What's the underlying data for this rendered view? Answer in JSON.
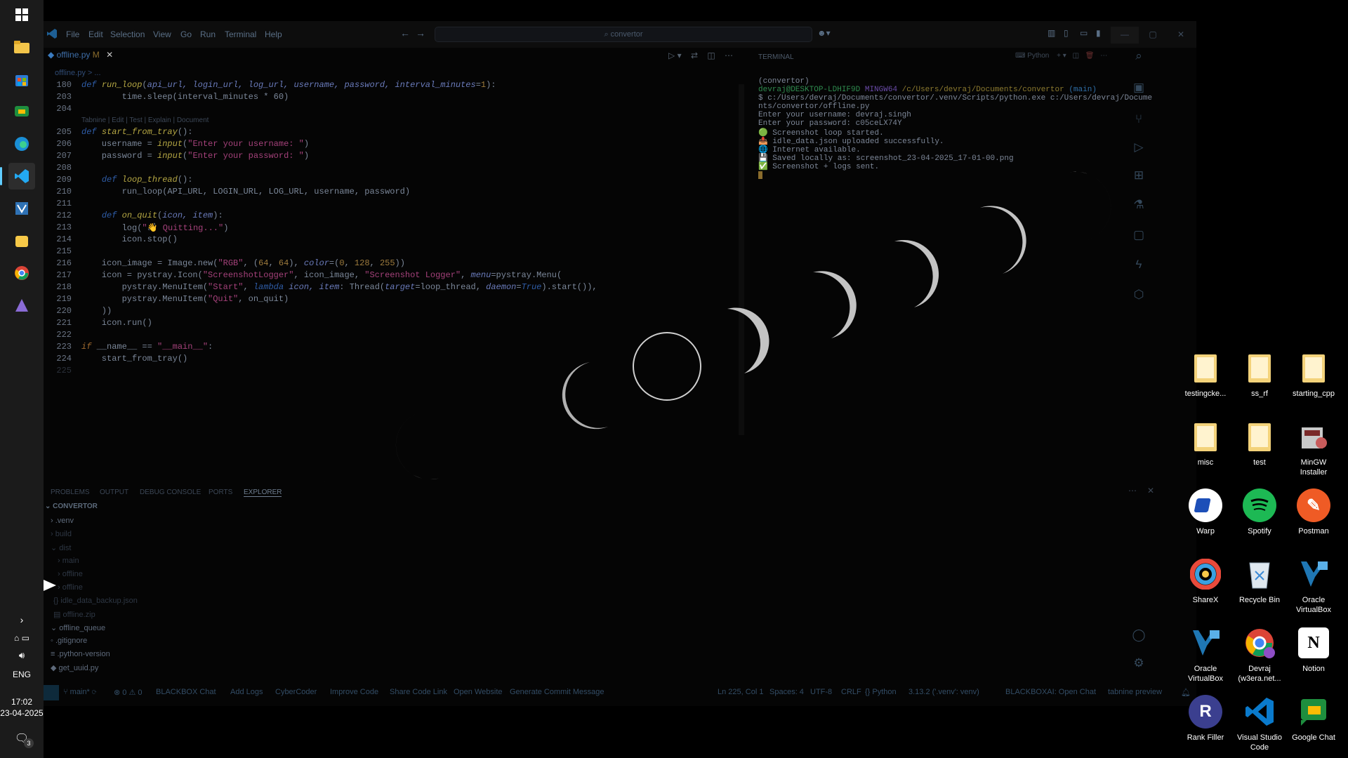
{
  "taskbar": {
    "lang": "ENG",
    "time": "17:02",
    "date": "23-04-2025",
    "notification_count": "3"
  },
  "titlebar": {
    "menu": [
      "File",
      "Edit",
      "Selection",
      "View",
      "Go",
      "Run",
      "Terminal",
      "Help"
    ],
    "search": "convertor"
  },
  "editor": {
    "tab_label": "offline.py",
    "tab_status": "M",
    "breadcrumb": "offline.py > ...",
    "codelens": "Tabnine | Edit | Test | Explain | Document",
    "lines": [
      {
        "n": "180",
        "t": "def run_loop(api_url, login_url, log_url, username, password, interval_minutes=1):"
      },
      {
        "n": "203",
        "t": "        time.sleep(interval_minutes * 60)"
      },
      {
        "n": "204",
        "t": ""
      },
      {
        "n": "205",
        "t": "def start_from_tray():"
      },
      {
        "n": "206",
        "t": "    username = input(\"Enter your username: \")"
      },
      {
        "n": "207",
        "t": "    password = input(\"Enter your password: \")"
      },
      {
        "n": "208",
        "t": ""
      },
      {
        "n": "209",
        "t": "    def loop_thread():"
      },
      {
        "n": "210",
        "t": "        run_loop(API_URL, LOGIN_URL, LOG_URL, username, password)"
      },
      {
        "n": "211",
        "t": ""
      },
      {
        "n": "212",
        "t": "    def on_quit(icon, item):"
      },
      {
        "n": "213",
        "t": "        log(\"👋 Quitting...\")"
      },
      {
        "n": "214",
        "t": "        icon.stop()"
      },
      {
        "n": "215",
        "t": ""
      },
      {
        "n": "216",
        "t": "    icon_image = Image.new(\"RGB\", (64, 64), color=(0, 128, 255))"
      },
      {
        "n": "217",
        "t": "    icon = pystray.Icon(\"ScreenshotLogger\", icon_image, \"Screenshot Logger\", menu=pystray.Menu("
      },
      {
        "n": "218",
        "t": "        pystray.MenuItem(\"Start\", lambda icon, item: Thread(target=loop_thread, daemon=True).start()),"
      },
      {
        "n": "219",
        "t": "        pystray.MenuItem(\"Quit\", on_quit)"
      },
      {
        "n": "220",
        "t": "    ))"
      },
      {
        "n": "221",
        "t": "    icon.run()"
      },
      {
        "n": "222",
        "t": ""
      },
      {
        "n": "223",
        "t": "if __name__ == \"__main__\":"
      },
      {
        "n": "224",
        "t": "    start_from_tray()"
      },
      {
        "n": "225",
        "t": ""
      }
    ]
  },
  "terminal": {
    "title": "TERMINAL",
    "shell": "Python",
    "lines": [
      "(convertor)",
      "devraj@DESKTOP-LDHIF9D MINGW64 /c/Users/devraj/Documents/convertor (main)",
      "$ c:/Users/devraj/Documents/convertor/.venv/Scripts/python.exe c:/Users/devraj/Docume",
      "nts/convertor/offline.py",
      "Enter your username: devraj.singh",
      "Enter your password: c05ceLX74Y",
      "🟢 Screenshot loop started.",
      "📤 idle_data.json uploaded successfully.",
      "🌐 Internet available.",
      "💾 Saved locally as: screenshot_23-04-2025_17-01-00.png",
      "✅ Screenshot + logs sent."
    ]
  },
  "panel": {
    "tabs": [
      "PROBLEMS",
      "OUTPUT",
      "DEBUG CONSOLE",
      "PORTS",
      "EXPLORER"
    ],
    "root": "CONVERTOR",
    "tree": [
      ".venv",
      "build",
      "dist",
      "main",
      "offline",
      "offline",
      "idle_data_backup.json",
      "offline.zip",
      "offline_queue",
      ".gitignore",
      ".python-version",
      "get_uuid.py"
    ]
  },
  "statusbar": {
    "branch": "main*",
    "problems": "⊗ 0 ⚠ 0",
    "items": [
      "BLACKBOX Chat",
      "Add Logs",
      "CyberCoder",
      "Improve Code",
      "Share Code Link",
      "Open Website",
      "Generate Commit Message"
    ],
    "right": [
      "Ln 225, Col 1",
      "Spaces: 4",
      "UTF-8",
      "CRLF",
      "{} Python",
      "3.13.2 ('.venv': venv)",
      "BLACKBOXAI: Open Chat",
      "tabnine preview"
    ]
  },
  "desktop": [
    {
      "label": "testingcke...",
      "icon": "folder-icon",
      "color": "#e8c46a"
    },
    {
      "label": "ss_rf",
      "icon": "folder-icon",
      "color": "#e8c46a"
    },
    {
      "label": "starting_cpp",
      "icon": "folder-icon",
      "color": "#e8c46a"
    },
    {
      "label": "misc",
      "icon": "folder-icon",
      "color": "#e8c46a"
    },
    {
      "label": "test",
      "icon": "folder-icon",
      "color": "#e8c46a"
    },
    {
      "label": "MinGW Installer",
      "icon": "installer-icon",
      "color": "#b64b4b"
    },
    {
      "label": "Warp",
      "icon": "warp-icon",
      "color": "#1d4fb8"
    },
    {
      "label": "Spotify",
      "icon": "spotify-icon",
      "color": "#1db954"
    },
    {
      "label": "Postman",
      "icon": "postman-icon",
      "color": "#ef5b25"
    },
    {
      "label": "ShareX",
      "icon": "sharex-icon",
      "color": "#3aa0e0"
    },
    {
      "label": "Recycle Bin",
      "icon": "recycle-bin-icon",
      "color": "#7a8a99"
    },
    {
      "label": "Oracle VirtualBox",
      "icon": "virtualbox-icon",
      "color": "#1f77b4"
    },
    {
      "label": "Oracle VirtualBox",
      "icon": "virtualbox-icon",
      "color": "#1f77b4"
    },
    {
      "label": "Devraj (w3era.net...",
      "icon": "chrome-icon",
      "color": "#db4437"
    },
    {
      "label": "Notion",
      "icon": "notion-icon",
      "color": "#ffffff"
    },
    {
      "label": "Rank Filler",
      "icon": "rank-filler-icon",
      "color": "#3b3f8f"
    },
    {
      "label": "Visual Studio Code",
      "icon": "vscode-icon",
      "color": "#0a7acc"
    },
    {
      "label": "Google Chat",
      "icon": "google-chat-icon",
      "color": "#1e8e3e"
    }
  ]
}
